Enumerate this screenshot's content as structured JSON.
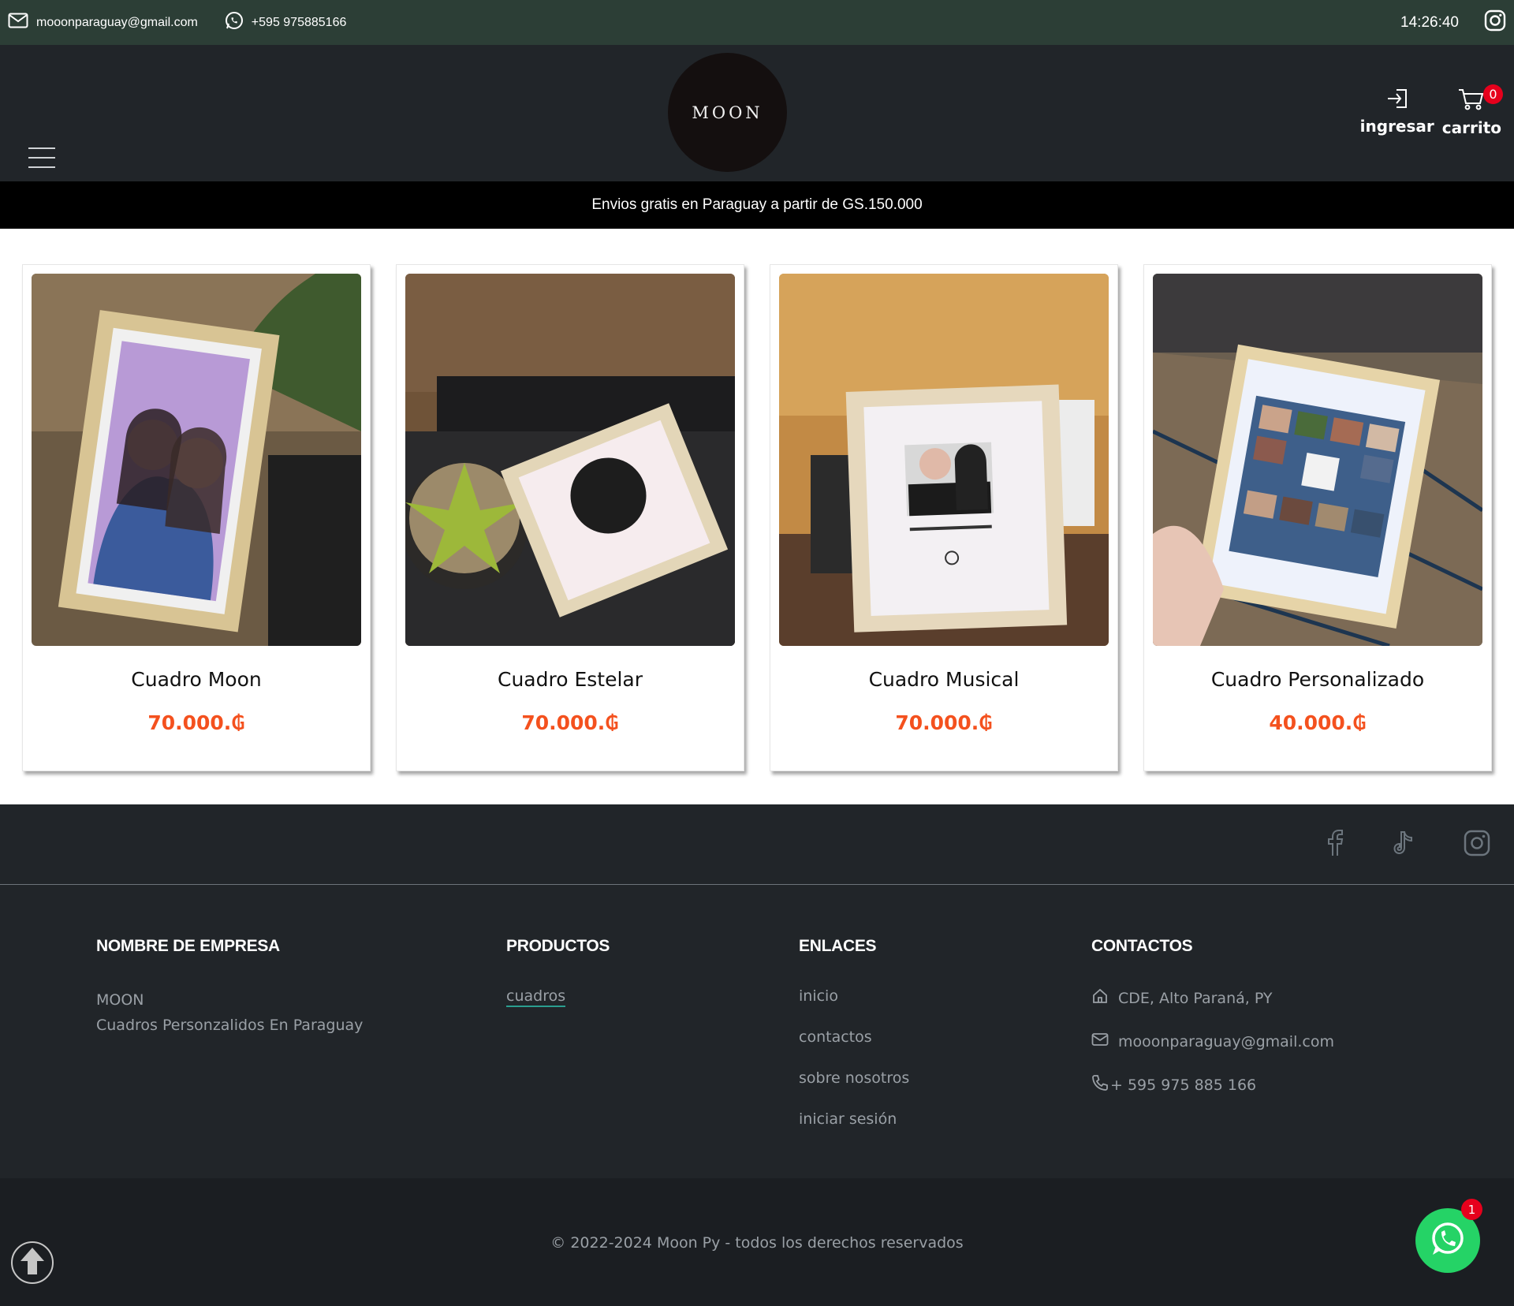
{
  "topbar": {
    "email": "mooonparaguay@gmail.com",
    "phone": "+595 975885166",
    "time": "14:26:40",
    "icons": [
      "mail-icon",
      "whatsapp-icon",
      "instagram-icon"
    ]
  },
  "header": {
    "logo_text": "MOON",
    "login_label": "ingresar",
    "cart_label": "carrito",
    "cart_count": "0"
  },
  "shipping_banner": "Envios gratis en Paraguay a partir de GS.150.000",
  "products": [
    {
      "name": "Cuadro Moon",
      "price": "70.000.₲"
    },
    {
      "name": "Cuadro Estelar",
      "price": "70.000.₲"
    },
    {
      "name": "Cuadro Musical",
      "price": "70.000.₲"
    },
    {
      "name": "Cuadro Personalizado",
      "price": "40.000.₲"
    }
  ],
  "footer": {
    "social_icons": [
      "facebook-icon",
      "tiktok-icon",
      "instagram-icon"
    ],
    "company": {
      "heading": "NOMBRE DE EMPRESA",
      "name": "MOON",
      "tagline": "Cuadros Personzalidos En Paraguay"
    },
    "productos": {
      "heading": "PRODUCTOS",
      "link": "cuadros"
    },
    "enlaces": {
      "heading": "ENLACES",
      "links": [
        "inicio",
        "contactos",
        "sobre nosotros",
        "iniciar sesión"
      ]
    },
    "contactos": {
      "heading": "CONTACTOS",
      "address": "CDE, Alto Paraná, PY",
      "email": "mooonparaguay@gmail.com",
      "phone": "+ 595 975 885 166"
    },
    "copyright": "© 2022-2024 Moon Py - todos los derechos reservados",
    "whatsapp_badge": "1"
  },
  "colors": {
    "topbar": "#2c3e36",
    "header": "#212529",
    "price": "#f4511e",
    "whatsapp": "#25d366"
  }
}
